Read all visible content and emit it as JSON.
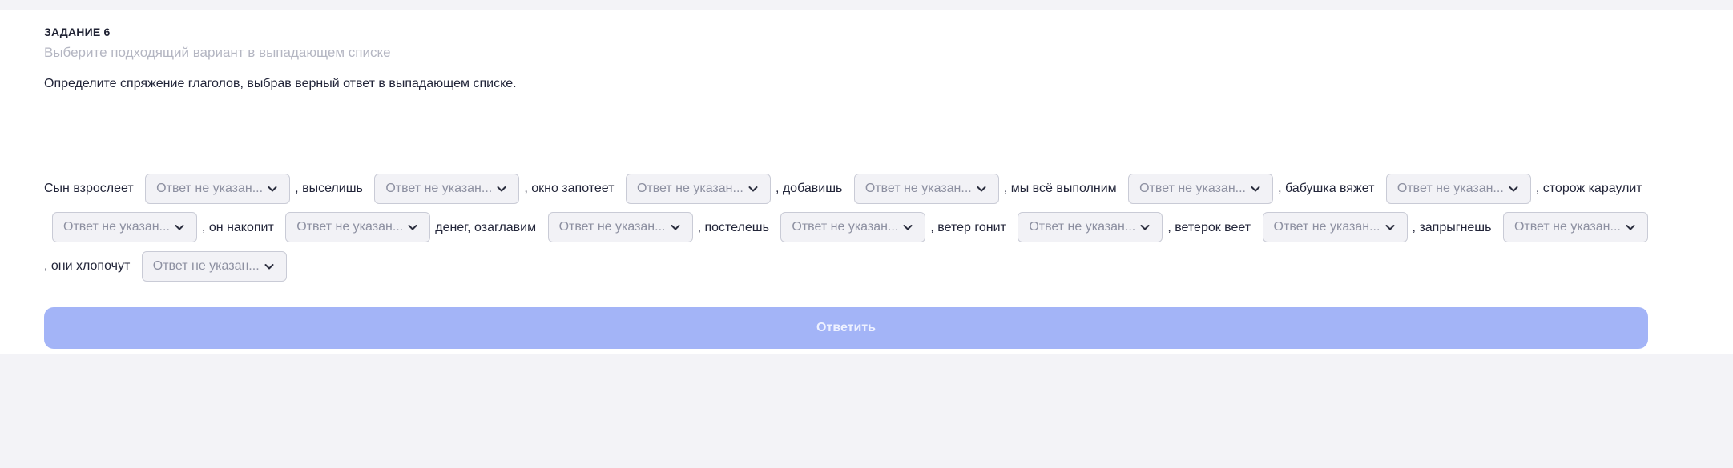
{
  "task": {
    "title": "ЗАДАНИЕ 6",
    "hint": "Выберите подходящий вариант в выпадающем списке",
    "question": "Определите спряжение глаголов, выбрав верный ответ в выпадающем списке."
  },
  "dropdown_placeholder": "Ответ не указан...",
  "sentence": {
    "seg_1": "Сын взрослеет",
    "seg_2": ", выселишь",
    "seg_3": ", окно запотеет",
    "seg_4": ", добавишь",
    "seg_5": ", мы всё выполним",
    "seg_6": ", бабушка вяжет",
    "seg_7": ", сторож караулит",
    "seg_8": ", он накопит",
    "seg_9": "денег, озаглавим",
    "seg_10": ", постелешь",
    "seg_11": ", ветер гонит",
    "seg_12": ", ветерок веет",
    "seg_13": ", запрыгнешь",
    "seg_14": ", они хлопочут"
  },
  "actions": {
    "submit_label": "Ответить"
  }
}
